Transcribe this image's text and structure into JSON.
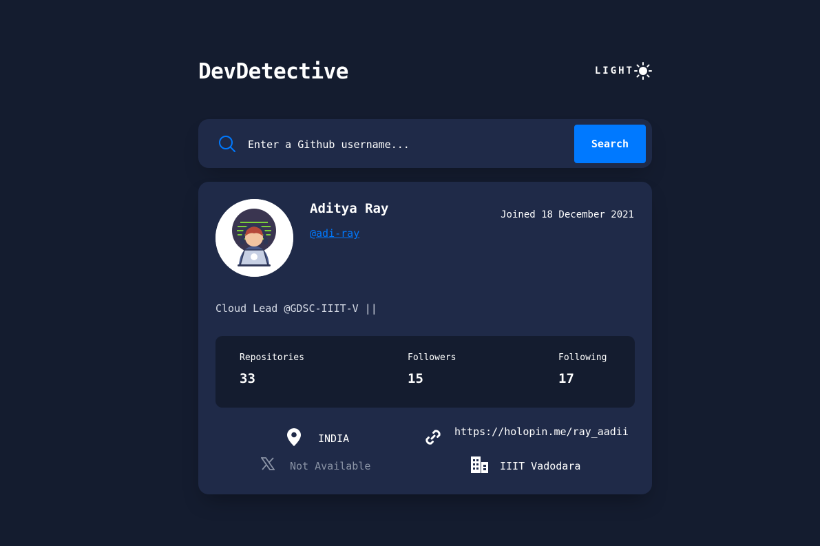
{
  "header": {
    "app_title": "DevDetective",
    "theme_label": "LIGHT",
    "theme_icon": "sun-icon"
  },
  "search": {
    "placeholder": "Enter a Github username...",
    "value": "",
    "button_label": "Search",
    "icon": "search-icon"
  },
  "profile": {
    "name": "Aditya Ray",
    "login": "@adi-ray",
    "joined": "Joined 18 December 2021",
    "bio": "Cloud Lead @GDSC-IIIT-V ||",
    "stats": [
      {
        "label": "Repositories",
        "value": "33"
      },
      {
        "label": "Followers",
        "value": "15"
      },
      {
        "label": "Following",
        "value": "17"
      }
    ],
    "links": {
      "location": "INDIA",
      "website": "https://holopin.me/ray_aadii",
      "twitter": "Not Available",
      "company": "IIIT Vadodara"
    }
  },
  "colors": {
    "background": "#141c2f",
    "card": "#1f2a48",
    "accent": "#0079ff",
    "text": "#ffffff",
    "muted": "#8b94a6"
  }
}
